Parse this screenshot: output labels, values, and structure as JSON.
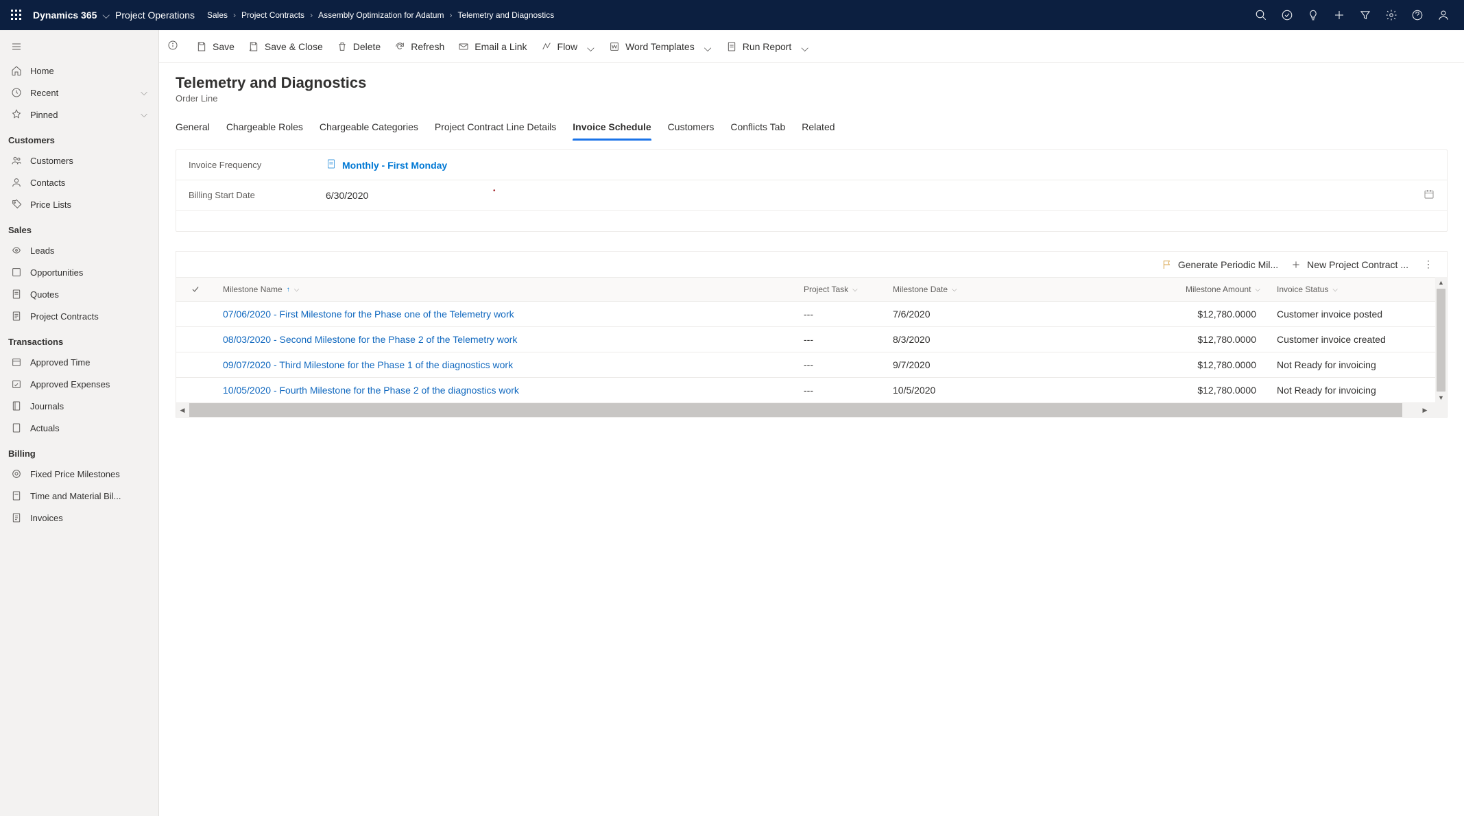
{
  "header": {
    "brand": "Dynamics 365",
    "app": "Project Operations",
    "breadcrumb": [
      "Sales",
      "Project Contracts",
      "Assembly Optimization for Adatum",
      "Telemetry and Diagnostics"
    ]
  },
  "sidebar": {
    "top": [
      {
        "icon": "home",
        "label": "Home"
      },
      {
        "icon": "clock",
        "label": "Recent",
        "chevron": true
      },
      {
        "icon": "pin",
        "label": "Pinned",
        "chevron": true
      }
    ],
    "groups": [
      {
        "title": "Customers",
        "items": [
          {
            "icon": "people",
            "label": "Customers"
          },
          {
            "icon": "person",
            "label": "Contacts"
          },
          {
            "icon": "pricetag",
            "label": "Price Lists"
          }
        ]
      },
      {
        "title": "Sales",
        "items": [
          {
            "icon": "lead",
            "label": "Leads"
          },
          {
            "icon": "opportunity",
            "label": "Opportunities"
          },
          {
            "icon": "quote",
            "label": "Quotes"
          },
          {
            "icon": "contract",
            "label": "Project Contracts"
          }
        ]
      },
      {
        "title": "Transactions",
        "items": [
          {
            "icon": "time",
            "label": "Approved Time"
          },
          {
            "icon": "expense",
            "label": "Approved Expenses"
          },
          {
            "icon": "journal",
            "label": "Journals"
          },
          {
            "icon": "actuals",
            "label": "Actuals"
          }
        ]
      },
      {
        "title": "Billing",
        "items": [
          {
            "icon": "milestone",
            "label": "Fixed Price Milestones"
          },
          {
            "icon": "tmbill",
            "label": "Time and Material Bil..."
          },
          {
            "icon": "invoice",
            "label": "Invoices"
          }
        ]
      }
    ]
  },
  "commandbar": [
    {
      "icon": "save",
      "label": "Save"
    },
    {
      "icon": "saveclose",
      "label": "Save & Close"
    },
    {
      "icon": "delete",
      "label": "Delete"
    },
    {
      "icon": "refresh",
      "label": "Refresh"
    },
    {
      "icon": "email",
      "label": "Email a Link"
    },
    {
      "icon": "flow",
      "label": "Flow",
      "chevron": true
    },
    {
      "icon": "word",
      "label": "Word Templates",
      "chevron": true
    },
    {
      "icon": "report",
      "label": "Run Report",
      "chevron": true
    }
  ],
  "page": {
    "title": "Telemetry and Diagnostics",
    "subtitle": "Order Line",
    "tabs": [
      "General",
      "Chargeable Roles",
      "Chargeable Categories",
      "Project Contract Line Details",
      "Invoice Schedule",
      "Customers",
      "Conflicts Tab",
      "Related"
    ],
    "active_tab": "Invoice Schedule",
    "form": {
      "invoice_frequency": {
        "label": "Invoice Frequency",
        "value": "Monthly - First Monday"
      },
      "billing_start_date": {
        "label": "Billing Start Date",
        "value": "6/30/2020"
      }
    }
  },
  "grid": {
    "toolbar": {
      "generate": "Generate Periodic Mil...",
      "new": "New Project Contract ..."
    },
    "columns": {
      "name": "Milestone Name",
      "task": "Project Task",
      "date": "Milestone Date",
      "amount": "Milestone Amount",
      "status": "Invoice Status"
    },
    "rows": [
      {
        "name": "07/06/2020 - First Milestone for the Phase one of the Telemetry work",
        "task": "---",
        "date": "7/6/2020",
        "amount": "$12,780.0000",
        "status": "Customer invoice posted"
      },
      {
        "name": "08/03/2020 - Second Milestone for the Phase 2 of the Telemetry work",
        "task": "---",
        "date": "8/3/2020",
        "amount": "$12,780.0000",
        "status": "Customer invoice created"
      },
      {
        "name": "09/07/2020 -  Third Milestone for the Phase 1 of the diagnostics work",
        "task": "---",
        "date": "9/7/2020",
        "amount": "$12,780.0000",
        "status": "Not Ready for invoicing"
      },
      {
        "name": "10/05/2020 -  Fourth Milestone for the Phase 2 of the diagnostics work",
        "task": "---",
        "date": "10/5/2020",
        "amount": "$12,780.0000",
        "status": "Not Ready for invoicing"
      }
    ]
  }
}
